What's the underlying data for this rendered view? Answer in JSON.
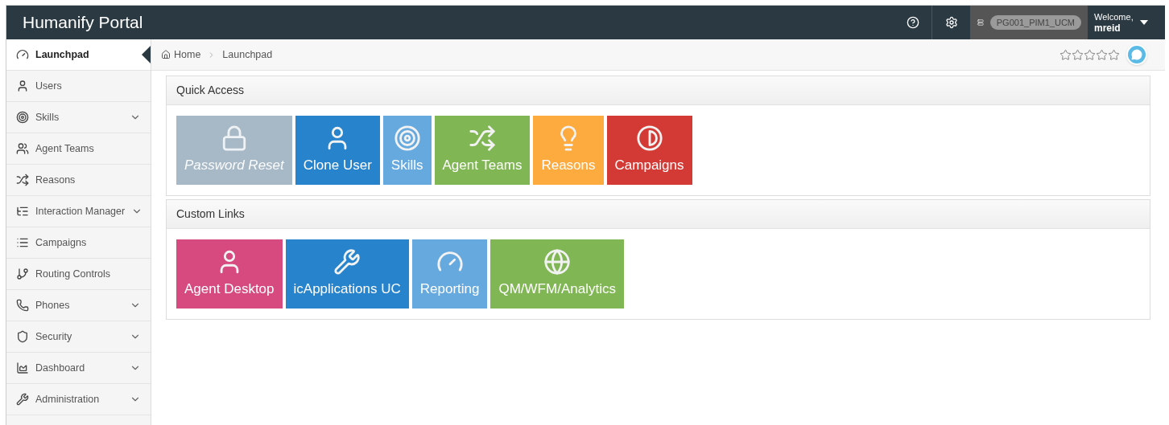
{
  "header": {
    "title": "Humanify Portal",
    "server": "PG001_PIM1_UCM",
    "welcome": "Welcome,",
    "user": "mreid"
  },
  "sidebar": {
    "items": [
      {
        "label": "Launchpad",
        "selected": true,
        "expandable": false
      },
      {
        "label": "Users",
        "selected": false,
        "expandable": false
      },
      {
        "label": "Skills",
        "selected": false,
        "expandable": true
      },
      {
        "label": "Agent Teams",
        "selected": false,
        "expandable": false
      },
      {
        "label": "Reasons",
        "selected": false,
        "expandable": false
      },
      {
        "label": "Interaction Manager",
        "selected": false,
        "expandable": true
      },
      {
        "label": "Campaigns",
        "selected": false,
        "expandable": false
      },
      {
        "label": "Routing Controls",
        "selected": false,
        "expandable": false
      },
      {
        "label": "Phones",
        "selected": false,
        "expandable": true
      },
      {
        "label": "Security",
        "selected": false,
        "expandable": true
      },
      {
        "label": "Dashboard",
        "selected": false,
        "expandable": true
      },
      {
        "label": "Administration",
        "selected": false,
        "expandable": true
      }
    ]
  },
  "breadcrumb": [
    "Home",
    "Launchpad"
  ],
  "rating": {
    "stars": 0
  },
  "panels": [
    {
      "title": "Quick Access",
      "tiles": [
        {
          "label": "Password Reset",
          "color": "#a7b8c6",
          "disabled": true
        },
        {
          "label": "Clone User",
          "color": "#2783cc",
          "disabled": false
        },
        {
          "label": "Skills",
          "color": "#66a9de",
          "disabled": false
        },
        {
          "label": "Agent Teams",
          "color": "#80b654",
          "disabled": false
        },
        {
          "label": "Reasons",
          "color": "#fdaa3f",
          "disabled": false
        },
        {
          "label": "Campaigns",
          "color": "#d43a35",
          "disabled": false
        }
      ]
    },
    {
      "title": "Custom Links",
      "tiles": [
        {
          "label": "Agent Desktop",
          "color": "#d74a7f",
          "disabled": false
        },
        {
          "label": "icApplications UC",
          "color": "#2783cc",
          "disabled": false
        },
        {
          "label": "Reporting",
          "color": "#66a9de",
          "disabled": false
        },
        {
          "label": "QM/WFM/Analytics",
          "color": "#80b654",
          "disabled": false
        }
      ]
    }
  ]
}
